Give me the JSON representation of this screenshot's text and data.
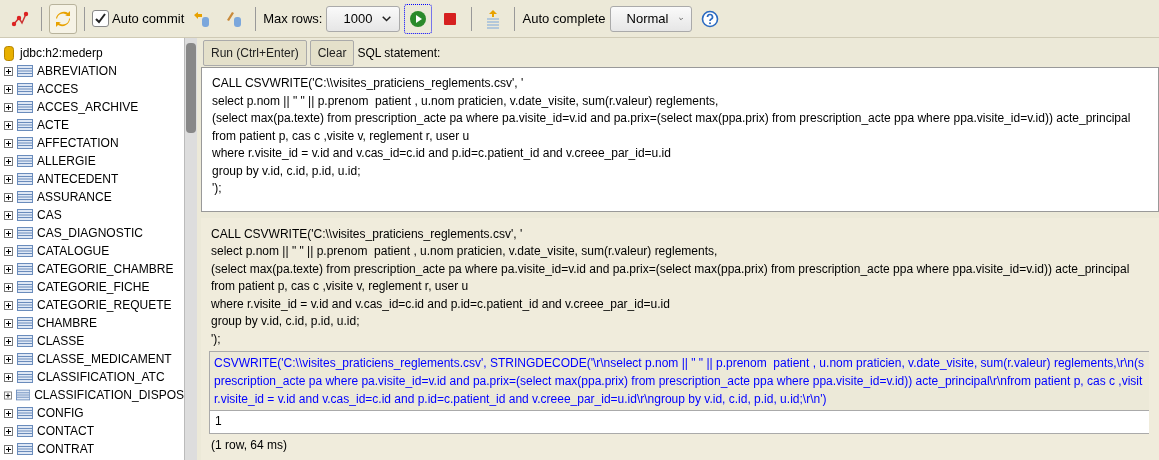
{
  "toolbar": {
    "refresh_toggle": {
      "pressed": true
    },
    "auto_commit": {
      "label": "Auto commit",
      "checked": true
    },
    "max_rows": {
      "label": "Max rows:",
      "value": "1000"
    },
    "auto_complete": {
      "label": "Auto complete",
      "value": "Normal"
    }
  },
  "tree": {
    "root": "jdbc:h2:mederp",
    "tables": [
      {
        "name": "ABREVIATION",
        "expanded": false
      },
      {
        "name": "ACCES",
        "expanded": false
      },
      {
        "name": "ACCES_ARCHIVE",
        "expanded": false
      },
      {
        "name": "ACTE",
        "expanded": false
      },
      {
        "name": "AFFECTATION",
        "expanded": false
      },
      {
        "name": "ALLERGIE",
        "expanded": false
      },
      {
        "name": "ANTECEDENT",
        "expanded": false
      },
      {
        "name": "ASSURANCE",
        "expanded": false
      },
      {
        "name": "CAS",
        "expanded": false
      },
      {
        "name": "CAS_DIAGNOSTIC",
        "expanded": false
      },
      {
        "name": "CATALOGUE",
        "expanded": false
      },
      {
        "name": "CATEGORIE_CHAMBRE",
        "expanded": false
      },
      {
        "name": "CATEGORIE_FICHE",
        "expanded": false
      },
      {
        "name": "CATEGORIE_REQUETE",
        "expanded": false
      },
      {
        "name": "CHAMBRE",
        "expanded": false
      },
      {
        "name": "CLASSE",
        "expanded": false
      },
      {
        "name": "CLASSE_MEDICAMENT",
        "expanded": false
      },
      {
        "name": "CLASSIFICATION_ATC",
        "expanded": false
      },
      {
        "name": "CLASSIFICATION_DISPOS",
        "expanded": false
      },
      {
        "name": "CONFIG",
        "expanded": false
      },
      {
        "name": "CONTACT",
        "expanded": false
      },
      {
        "name": "CONTRAT",
        "expanded": false
      }
    ]
  },
  "editor": {
    "run_button": "Run (Ctrl+Enter)",
    "clear_button": "Clear",
    "label": "SQL statement:",
    "lines": [
      "CALL CSVWRITE('C:\\\\visites_praticiens_reglements.csv', '",
      "select p.nom || \" \" || p.prenom  patient , u.nom praticien, v.date_visite, sum(r.valeur) reglements,",
      "(select max(pa.texte) from prescription_acte pa where pa.visite_id=v.id and pa.prix=(select max(ppa.prix) from prescription_acte ppa where ppa.visite_id=v.id)) acte_principal",
      "from patient p, cas c ,visite v, reglement r, user u",
      "where r.visite_id = v.id and v.cas_id=c.id and p.id=c.patient_id and v.creee_par_id=u.id",
      "group by v.id, c.id, p.id, u.id;",
      "');"
    ]
  },
  "result": {
    "statement_lines": [
      "CALL CSVWRITE('C:\\\\visites_praticiens_reglements.csv', '",
      "select p.nom || \" \" || p.prenom  patient , u.nom praticien, v.date_visite, sum(r.valeur) reglements,",
      "(select max(pa.texte) from prescription_acte pa where pa.visite_id=v.id and pa.prix=(select max(ppa.prix) from prescription_acte ppa where ppa.visite_id=v.id)) acte_principal",
      "from patient p, cas c ,visite v, reglement r, user u",
      "where r.visite_id = v.id and v.cas_id=c.id and p.id=c.patient_id and v.creee_par_id=u.id",
      "group by v.id, c.id, p.id, u.id;",
      "');"
    ],
    "header_lines": [
      "CSVWRITE('C:\\\\visites_praticiens_reglements.csv', STRINGDECODE('\\r\\nselect p.nom || \" \" || p.prenom  patient , u.nom praticien, v.date_visite, sum(r.valeur) reglements,\\r\\n(s",
      "prescription_acte pa where pa.visite_id=v.id and pa.prix=(select max(ppa.prix) from prescription_acte ppa where ppa.visite_id=v.id)) acte_principal\\r\\nfrom patient p, cas c ,visit",
      "r.visite_id = v.id and v.cas_id=c.id and p.id=c.patient_id and v.creee_par_id=u.id\\r\\ngroup by v.id, c.id, p.id, u.id;\\r\\n')"
    ],
    "rows": [
      "1"
    ],
    "status": "(1 row, 64 ms)"
  }
}
